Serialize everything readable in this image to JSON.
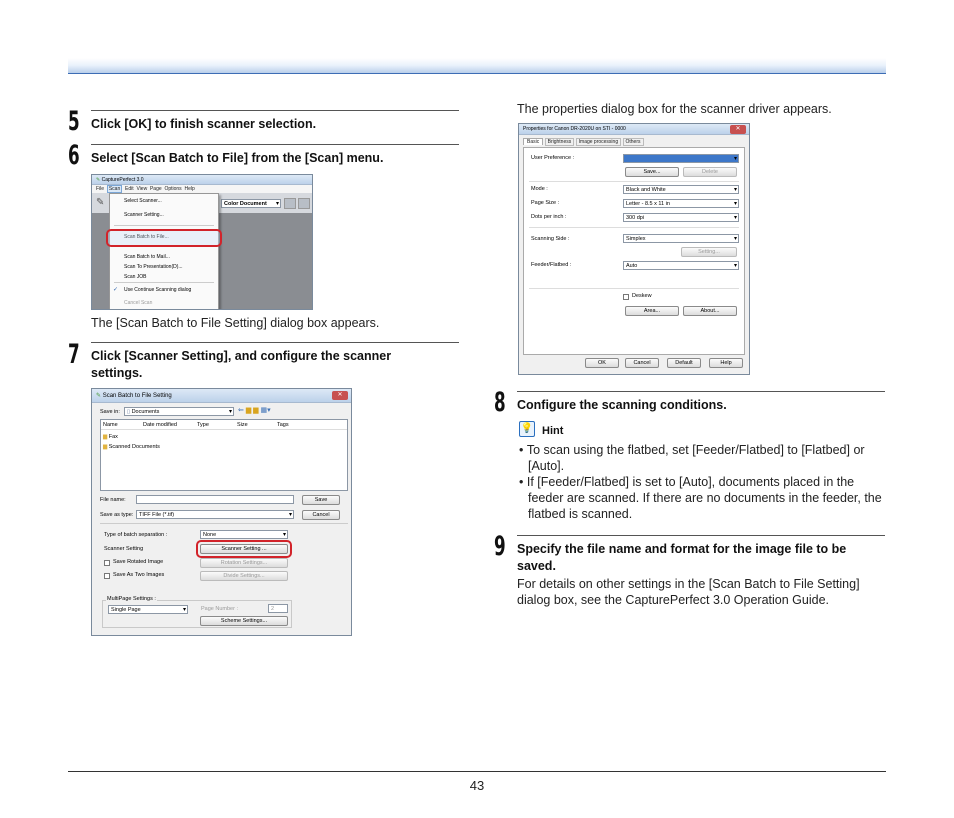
{
  "page_number": "43",
  "step5": {
    "num": "5",
    "text": "Click [OK] to finish scanner selection."
  },
  "step6": {
    "num": "6",
    "text": "Select [Scan Batch to File] from the [Scan] menu.",
    "after": "The [Scan Batch to File Setting] dialog box appears."
  },
  "step7": {
    "num": "7",
    "text": "Click [Scanner Setting], and configure the scanner settings."
  },
  "right_intro": "The properties dialog box for the scanner driver appears.",
  "step8": {
    "num": "8",
    "text": "Configure the scanning conditions.",
    "hint_label": "Hint",
    "bullets": [
      "To scan using the flatbed, set [Feeder/Flatbed] to [Flatbed] or [Auto].",
      "If [Feeder/Flatbed] is set to [Auto], documents placed in the feeder are scanned. If there are no documents in the feeder, the flatbed is scanned."
    ]
  },
  "step9": {
    "num": "9",
    "text": "Specify the file name and format for the image file to be saved.",
    "body": "For details on other settings in the [Scan Batch to File Setting] dialog box, see the CapturePerfect 3.0 Operation Guide."
  },
  "shot1": {
    "title": "CapturePerfect 3.0",
    "menubar": [
      "File",
      "Scan",
      "Edit",
      "View",
      "Page",
      "Options",
      "Help"
    ],
    "menu_items": [
      "Select Scanner...",
      "Scanner Setting...",
      "Scan Batch to File...",
      "Scan Batch to Mail...",
      "Scan To Presentation(D)...",
      "Scan JOB",
      "Use Continue Scanning dialog",
      "Cancel Scan"
    ],
    "mode_value": "Color Document"
  },
  "shot2": {
    "title": "Scan Batch to File Setting",
    "save_in_label": "Save in:",
    "save_in_value": "Documents",
    "columns": [
      "Name",
      "Date modified",
      "Type",
      "Size",
      "Tags"
    ],
    "folders": [
      "Fax",
      "Scanned Documents"
    ],
    "file_name_label": "File name:",
    "save_as_label": "Save as type:",
    "save_as_value": "TIFF File (*.tif)",
    "save_btn": "Save",
    "cancel_btn": "Cancel",
    "batch_sep_label": "Type of batch separation :",
    "batch_sep_value": "None",
    "scanner_setting_label": "Scanner Setting",
    "scanner_setting_btn": "Scanner Setting ...",
    "save_rotated": "Save Rotated Image",
    "rotation_btn": "Rotation Settings...",
    "save_two": "Save As Two Images",
    "divide_btn": "Divide Settings...",
    "multipage_label": "MultiPage Settings :",
    "multipage_value": "Single Page",
    "page_number_label": "Page Number :",
    "page_number_value": "2",
    "scheme_btn": "Scheme Settings..."
  },
  "shot3": {
    "title": "Properties for Canon DR-2020U on STI - 0000",
    "tabs": [
      "Basic",
      "Brightness",
      "Image processing",
      "Others"
    ],
    "user_pref_label": "User Preference :",
    "save_btn": "Save...",
    "delete_btn": "Delete",
    "mode_label": "Mode :",
    "mode_value": "Black and White",
    "page_size_label": "Page Size :",
    "page_size_value": "Letter - 8.5 x 11 in",
    "dpi_label": "Dots per inch :",
    "dpi_value": "300 dpi",
    "side_label": "Scanning Side :",
    "side_value": "Simplex",
    "setting_btn": "Setting...",
    "feeder_label": "Feeder/Flatbed :",
    "feeder_value": "Auto",
    "deskew_label": "Deskew",
    "area_btn": "Area...",
    "about_btn": "About...",
    "ok_btn": "OK",
    "cancel_btn": "Cancel",
    "default_btn": "Default",
    "help_btn": "Help"
  }
}
